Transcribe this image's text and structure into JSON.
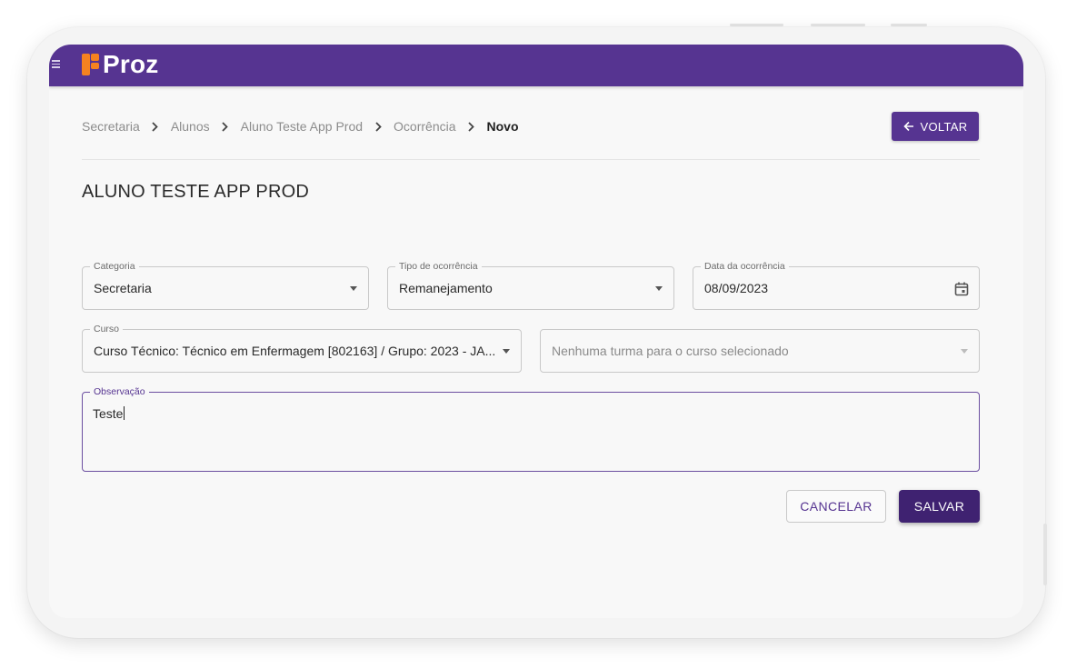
{
  "brand": {
    "name": "Proz",
    "bar_color": "#563491",
    "accent_color": "#f58220"
  },
  "breadcrumb": {
    "items": [
      "Secretaria",
      "Alunos",
      "Aluno Teste App Prod",
      "Ocorrência"
    ],
    "current": "Novo"
  },
  "back_button": {
    "label": "VOLTAR",
    "icon": "arrow-left-icon"
  },
  "page_title": "ALUNO TESTE APP PROD",
  "form": {
    "categoria": {
      "label": "Categoria",
      "value": "Secretaria",
      "icon": "chevron-down-icon"
    },
    "tipo_ocorrencia": {
      "label": "Tipo de ocorrência",
      "value": "Remanejamento",
      "icon": "chevron-down-icon"
    },
    "data_ocorrencia": {
      "label": "Data da ocorrência",
      "value": "08/09/2023",
      "icon": "calendar-icon"
    },
    "curso": {
      "label": "Curso",
      "value": "Curso Técnico: Técnico em Enfermagem [802163] / Grupo: 2023 - JA...",
      "icon": "chevron-down-icon"
    },
    "turma": {
      "placeholder": "Nenhuma turma para o curso selecionado",
      "icon": "chevron-down-icon"
    },
    "observacao": {
      "label": "Observação",
      "value": "Teste"
    }
  },
  "actions": {
    "cancel_label": "CANCELAR",
    "save_label": "SALVAR"
  }
}
